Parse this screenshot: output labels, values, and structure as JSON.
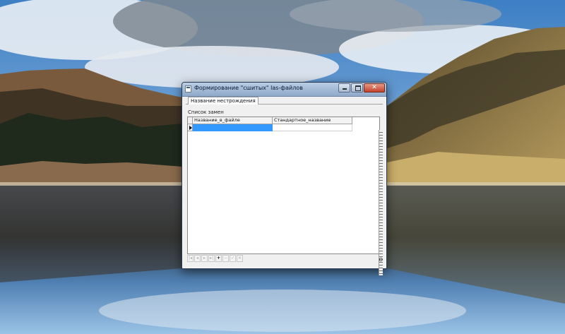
{
  "window": {
    "title": "Формирование \"сшитых\" las-файлов",
    "tab_label": "Название нестрождения",
    "section_label": "Список замен",
    "side_top_text": "М",
    "side_bottom_text": "О"
  },
  "grid": {
    "columns": [
      "Название_в_файле",
      "Стандартное_название"
    ],
    "rows": [
      {
        "cells": [
          "",
          ""
        ],
        "selected": true
      }
    ]
  },
  "navigator": {
    "buttons": [
      {
        "icon": "first-record-icon",
        "glyph": "|◂",
        "enabled": false
      },
      {
        "icon": "prior-record-icon",
        "glyph": "◂",
        "enabled": false
      },
      {
        "icon": "next-record-icon",
        "glyph": "▸",
        "enabled": false
      },
      {
        "icon": "last-record-icon",
        "glyph": "▸|",
        "enabled": false
      },
      {
        "icon": "insert-record-icon",
        "glyph": "+",
        "enabled": true
      },
      {
        "icon": "delete-record-icon",
        "glyph": "−",
        "enabled": false
      },
      {
        "icon": "post-edit-icon",
        "glyph": "✓",
        "enabled": false
      },
      {
        "icon": "cancel-edit-icon",
        "glyph": "✕",
        "enabled": false
      }
    ]
  },
  "colors": {
    "selection": "#3399ff",
    "title_bar": "#a8bfdc",
    "close_button": "#c94a33"
  }
}
